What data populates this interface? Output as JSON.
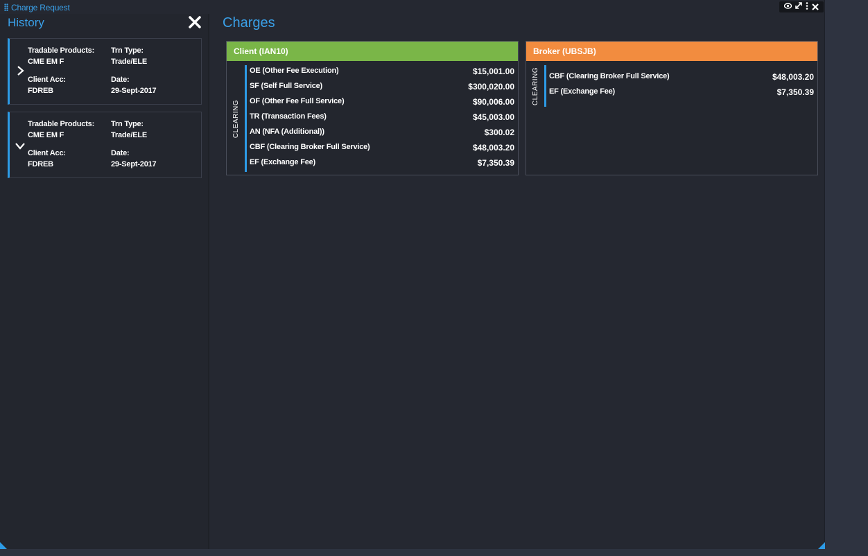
{
  "window": {
    "title": "Charge Request",
    "controls": [
      "eye-icon",
      "expand-icon",
      "more-icon",
      "close-icon"
    ]
  },
  "history": {
    "title": "History",
    "cards": [
      {
        "products_label": "Tradable Products:",
        "products_value": "CME EM F",
        "trn_label": "Trn Type:",
        "trn_value": "Trade/ELE",
        "acc_label": "Client Acc:",
        "acc_value": "FDREB",
        "date_label": "Date:",
        "date_value": "29-Sept-2017",
        "state": "collapsed"
      },
      {
        "products_label": "Tradable Products:",
        "products_value": "CME EM F",
        "trn_label": "Trn Type:",
        "trn_value": "Trade/ELE",
        "acc_label": "Client Acc:",
        "acc_value": "FDREB",
        "date_label": "Date:",
        "date_value": "29-Sept-2017",
        "state": "expanded"
      }
    ]
  },
  "charges": {
    "title": "Charges",
    "client": {
      "header": "Client (IAN10)",
      "color": "#7ab648",
      "group": "CLEARING",
      "fees": [
        {
          "name": "OE (Other Fee Execution)",
          "amount": "$15,001.00"
        },
        {
          "name": "SF (Self Full Service)",
          "amount": "$300,020.00"
        },
        {
          "name": "OF (Other Fee Full Service)",
          "amount": "$90,006.00"
        },
        {
          "name": "TR (Transaction Fees)",
          "amount": "$45,003.00"
        },
        {
          "name": "AN (NFA (Additional))",
          "amount": "$300.02"
        },
        {
          "name": "CBF (Clearing Broker Full Service)",
          "amount": "$48,003.20"
        },
        {
          "name": "EF (Exchange Fee)",
          "amount": "$7,350.39"
        }
      ]
    },
    "broker": {
      "header": "Broker (UBSJB)",
      "color": "#f28c3f",
      "group": "CLEARING",
      "fees": [
        {
          "name": "CBF (Clearing Broker Full Service)",
          "amount": "$48,003.20"
        },
        {
          "name": "EF (Exchange Fee)",
          "amount": "$7,350.39"
        }
      ]
    }
  },
  "colors": {
    "accent": "#3aa0e8",
    "background": "#252831"
  }
}
